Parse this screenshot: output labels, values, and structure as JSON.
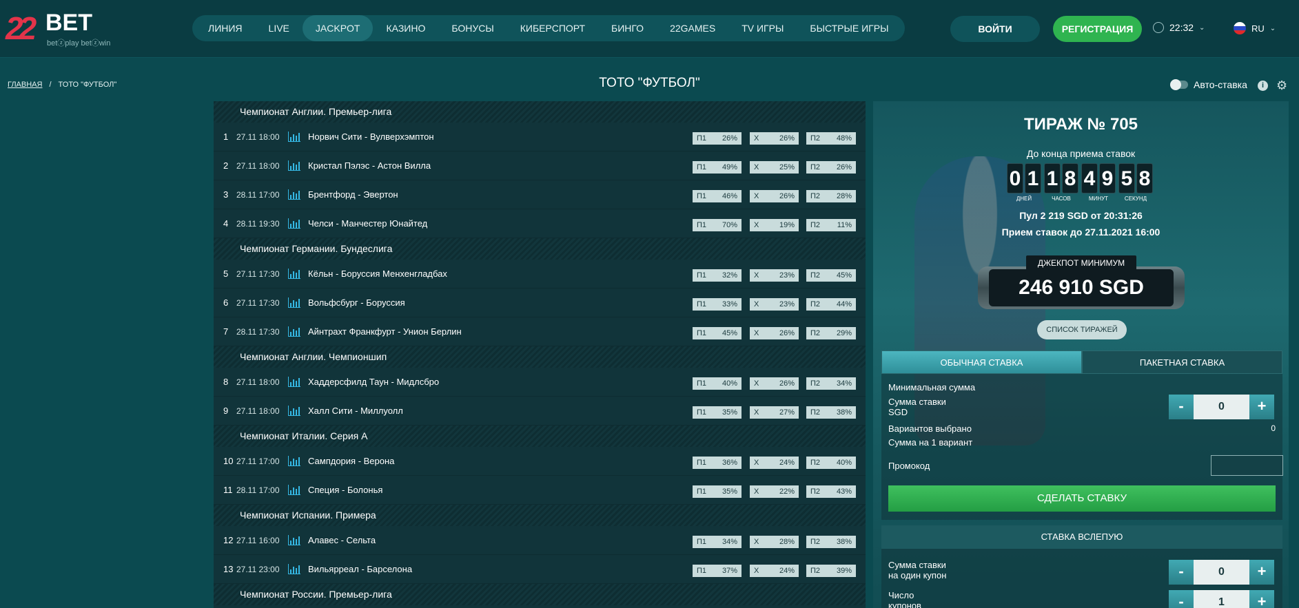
{
  "brand": {
    "logo_num": "22",
    "logo_text": "BET",
    "tagline": "betⓩplay  betⓩwin"
  },
  "nav": [
    "ЛИНИЯ",
    "LIVE",
    "JACKPOT",
    "КАЗИНО",
    "БОНУСЫ",
    "КИБЕРСПОРТ",
    "БИНГО",
    "22GAMES",
    "TV ИГРЫ",
    "БЫСТРЫЕ ИГРЫ"
  ],
  "nav_active": "JACKPOT",
  "header": {
    "login": "ВОЙТИ",
    "register": "РЕГИСТРАЦИЯ",
    "time": "22:32",
    "lang": "RU"
  },
  "breadcrumb": {
    "home": "ГЛАВНАЯ",
    "sep": "/",
    "current": "ТОТО \"ФУТБОЛ\""
  },
  "page_title": "ТОТО \"ФУТБОЛ\"",
  "autobet": "Авто-ставка",
  "leagues": [
    {
      "name": "Чемпионат Англии. Премьер-лига",
      "matches": [
        {
          "n": "1",
          "date": "27.11 18:00",
          "teams": "Норвич Сити - Вулверхэмптон",
          "p1": "26%",
          "x": "26%",
          "p2": "48%"
        },
        {
          "n": "2",
          "date": "27.11 18:00",
          "teams": "Кристал Пэлэс - Астон Вилла",
          "p1": "49%",
          "x": "25%",
          "p2": "26%"
        },
        {
          "n": "3",
          "date": "28.11 17:00",
          "teams": "Брентфорд - Эвертон",
          "p1": "46%",
          "x": "26%",
          "p2": "28%"
        },
        {
          "n": "4",
          "date": "28.11 19:30",
          "teams": "Челси - Манчестер Юнайтед",
          "p1": "70%",
          "x": "19%",
          "p2": "11%"
        }
      ]
    },
    {
      "name": "Чемпионат Германии. Бундеслига",
      "matches": [
        {
          "n": "5",
          "date": "27.11 17:30",
          "teams": "Кёльн - Боруссия Менхенгладбах",
          "p1": "32%",
          "x": "23%",
          "p2": "45%"
        },
        {
          "n": "6",
          "date": "27.11 17:30",
          "teams": "Вольфсбург - Боруссия",
          "p1": "33%",
          "x": "23%",
          "p2": "44%"
        },
        {
          "n": "7",
          "date": "28.11 17:30",
          "teams": "Айнтрахт Франкфурт - Унион Берлин",
          "p1": "45%",
          "x": "26%",
          "p2": "29%"
        }
      ]
    },
    {
      "name": "Чемпионат Англии. Чемпионшип",
      "matches": [
        {
          "n": "8",
          "date": "27.11 18:00",
          "teams": "Хаддерсфилд Таун - Мидлсбро",
          "p1": "40%",
          "x": "26%",
          "p2": "34%"
        },
        {
          "n": "9",
          "date": "27.11 18:00",
          "teams": "Халл Сити - Миллуолл",
          "p1": "35%",
          "x": "27%",
          "p2": "38%"
        }
      ]
    },
    {
      "name": "Чемпионат Италии. Серия А",
      "matches": [
        {
          "n": "10",
          "date": "27.11 17:00",
          "teams": "Сампдория - Верона",
          "p1": "36%",
          "x": "24%",
          "p2": "40%"
        },
        {
          "n": "11",
          "date": "28.11 17:00",
          "teams": "Специя - Болонья",
          "p1": "35%",
          "x": "22%",
          "p2": "43%"
        }
      ]
    },
    {
      "name": "Чемпионат Испании. Примера",
      "matches": [
        {
          "n": "12",
          "date": "27.11 16:00",
          "teams": "Алавес - Сельта",
          "p1": "34%",
          "x": "28%",
          "p2": "38%"
        },
        {
          "n": "13",
          "date": "27.11 23:00",
          "teams": "Вильярреал - Барселона",
          "p1": "37%",
          "x": "24%",
          "p2": "39%"
        }
      ]
    },
    {
      "name": "Чемпионат России. Премьер-лига",
      "matches": []
    }
  ],
  "odd_labels": {
    "p1": "П1",
    "x": "Х",
    "p2": "П2"
  },
  "panel": {
    "draw_title": "ТИРАЖ № 705",
    "till_end": "До конца приема ставок",
    "countdown": [
      {
        "digits": "01",
        "label": "ДНЕЙ"
      },
      {
        "digits": "18",
        "label": "ЧАСОВ"
      },
      {
        "digits": "49",
        "label": "МИНУТ"
      },
      {
        "digits": "58",
        "label": "СЕКУНД"
      }
    ],
    "pool": "Пул 2 219 SGD от 20:31:26",
    "accept_until": "Прием ставок до 27.11.2021 16:00",
    "jackpot_label": "ДЖЕКПОТ МИНИМУМ",
    "jackpot_value": "246 910 SGD",
    "draw_list": "СПИСОК ТИРАЖЕЙ",
    "tab_regular": "ОБЫЧНАЯ СТАВКА",
    "tab_package": "ПАКЕТНАЯ СТАВКА",
    "min_sum": "Минимальная сумма",
    "stake_sum_line1": "Сумма ставки",
    "stake_sum_line2": "SGD",
    "stake_value": "0",
    "variants_selected": "Вариантов выбрано",
    "variants_value": "0",
    "sum_per_variant": "Сумма на 1 вариант",
    "promo": "Промокод",
    "make_bet": "СДЕЛАТЬ СТАВКУ",
    "blind_title": "СТАВКА ВСЛЕПУЮ",
    "blind_sum_line1": "Сумма ставки",
    "blind_sum_line2": "на один купон",
    "blind_sum_value": "0",
    "coupons_line1": "Число",
    "coupons_line2": "купонов",
    "coupons_value": "1",
    "minus": "-",
    "plus": "+"
  }
}
